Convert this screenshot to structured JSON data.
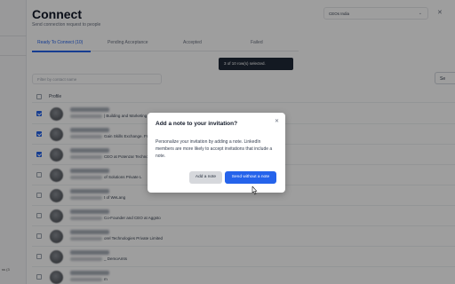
{
  "header": {
    "title": "Connect",
    "subtitle": "Send connection request to people",
    "dropdown_value": "CEOs India",
    "dropdown_chevron": "chevron-down-icon",
    "close_icon": "close-icon"
  },
  "tabs": [
    {
      "label": "Ready To Connect (10)"
    },
    {
      "label": "Pending Acceptance"
    },
    {
      "label": "Accepted"
    },
    {
      "label": "Failed"
    }
  ],
  "selection_pill": "3 of 10 row(s) selected.",
  "filter": {
    "placeholder": "Filter by contact name"
  },
  "right_button": "Se",
  "table": {
    "header_label": "Profile",
    "rows": [
      {
        "checked": true,
        "desc": "| Building and Marketing"
      },
      {
        "checked": true,
        "desc": "Gain Skills Exchange. Fre"
      },
      {
        "checked": true,
        "desc": "CEO at Potenzar Techno"
      },
      {
        "checked": false,
        "desc": "of Solutions Private L"
      },
      {
        "checked": false,
        "desc": "t of WeLang"
      },
      {
        "checked": false,
        "desc": "Co-Founder and CEO at Aggsto"
      },
      {
        "checked": false,
        "desc": "orel Technologies Private Limited"
      },
      {
        "checked": false,
        "desc": "_ DemoAmts"
      },
      {
        "checked": false,
        "desc": "m"
      }
    ]
  },
  "sidebar": {
    "footer_text": "ss (3"
  },
  "dialog": {
    "title": "Add a note to your invitation?",
    "body": "Personalize your invitation by adding a note. LinkedIn members are more likely to accept invitations that include a note.",
    "add_note_label": "Add a note",
    "send_without_label": "Send without a note",
    "close_icon": "close-icon"
  },
  "colors": {
    "accent": "#2563eb",
    "overlay": "rgba(0,0,0,0.38)"
  }
}
